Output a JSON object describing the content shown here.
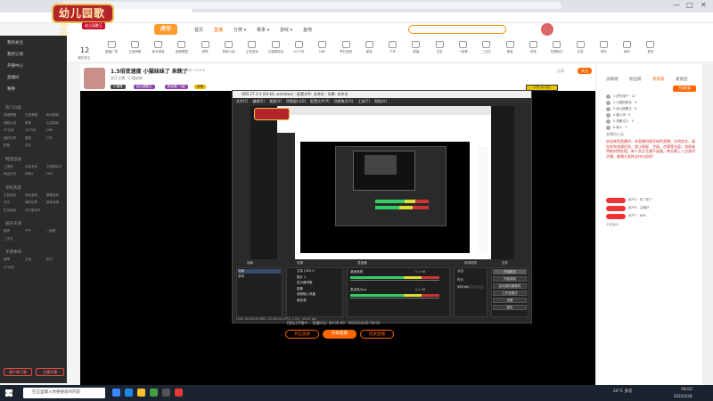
{
  "browser": {
    "tabs": [
      {
        "label": "虎牙直播-中国领先的互动直播平台"
      },
      {
        "label": "抖音直播-中国领先的互动直播..."
      },
      {
        "label": "新标签页"
      }
    ],
    "new_tab": "+",
    "win_controls": [
      "—",
      "□",
      "✕"
    ]
  },
  "overlay_logo": {
    "text": "幼儿园歌王",
    "sub": "幼儿园歌王"
  },
  "site": {
    "logo_text": "虎牙",
    "nav": [
      "首页",
      "直播",
      "分类 ▾",
      "赛事 ▾",
      "游戏 ▾",
      "鱼吧"
    ],
    "active_nav": 1,
    "follow_count": "12",
    "follow_label": "我的关注",
    "icon_row": [
      "直播广场",
      "王者荣耀",
      "和平精英",
      "英雄联盟",
      "原神",
      "穿越火线",
      "主机游戏",
      "王者模拟战",
      "QQ飞车",
      "DNF",
      "梦幻西游",
      "星秀",
      "户外",
      "颜值",
      "交友",
      "一起看",
      "二次元",
      "美食",
      "体育",
      "吃喝玩乐",
      "手游",
      "单机",
      "娱乐",
      "更多"
    ]
  },
  "sidebar": {
    "items": [
      "我的关注",
      "我的订阅",
      "开播中心",
      "直播间",
      "赛事"
    ],
    "section1": "热门分类",
    "grid1": [
      "英雄联盟",
      "王者荣耀",
      "和平精英",
      "穿越火线",
      "原神",
      "主机游戏",
      "CF手游",
      "QQ飞车",
      "DNF",
      "我的世界",
      "星秀",
      "户外",
      "颜值",
      "交友"
    ],
    "section2": "网游竞技",
    "grid2": [
      "三国杀",
      "永劫无间",
      "天涯明月刀",
      "命运方舟",
      "剑网3",
      "FIFA"
    ],
    "section3": "单机热游",
    "grid3": [
      "主机游戏",
      "怀旧游戏",
      "暴雪游戏",
      "方舟",
      "我的世界",
      "使命召唤",
      "生化危机",
      "艾尔登法环"
    ],
    "section4": "娱乐天地",
    "grid4": [
      "星秀",
      "户外",
      "一起看",
      "二次元"
    ],
    "section5": "手游休闲",
    "grid5": [
      "原神",
      "王者",
      "和平",
      "CF手游"
    ],
    "footer_btns": [
      "客户端下载",
      "主播开播"
    ]
  },
  "stream": {
    "title": "1.5倍变速度 小猫妹妹了 来晚了",
    "subtitle": "虎牙主播 · 小猫妹妹",
    "room_no": "房间号 123456",
    "badges": [
      "小猫咪",
      "幼儿园歌王",
      "粉丝团 · 1级",
      "虎粮"
    ],
    "actions": [
      "分享",
      "关注"
    ],
    "popularity": "人气 12.3万"
  },
  "obs": {
    "title": "OBS 27.2.4 (64 bit, windows) - 配置文件: 未命名 - 场景: 未命名",
    "menu": [
      "文件(F)",
      "编辑(E)",
      "视图(V)",
      "停靠窗口(D)",
      "配置文件(P)",
      "场景集合(S)",
      "工具(T)",
      "帮助(H)"
    ],
    "panels": [
      "场景",
      "来源",
      "混音器",
      "转场特效",
      "控件"
    ],
    "scenes": [
      "场景",
      "游戏"
    ],
    "sources": [
      "文本 (GDI+)",
      "图片 2",
      "显示器采集",
      "图像",
      "音频输入采集",
      "媒体源"
    ],
    "mixer": [
      "桌面音频",
      "麦克风/Aux"
    ],
    "mixer_db": [
      "0.0 dB",
      "0.0 dB"
    ],
    "transition": {
      "label": "淡出",
      "duration_label": "时长",
      "duration": "300 ms"
    },
    "controls": [
      "开始推流",
      "开始录制",
      "启动虚拟摄像机",
      "工作室模式",
      "设置",
      "退出"
    ],
    "status": "LIVE: 00:00:00   REC: 00:00:00   CPU: 2.3%, 30.00 fps"
  },
  "below_video": {
    "caption": "[图标]开播中... 直播时长: 00:00:00 · 2022/03/28 18:02",
    "btns": [
      "开启美颜",
      "开始直播",
      "结束直播"
    ]
  },
  "right_panel": {
    "tabs": [
      "贡献榜",
      "粉丝榜",
      "贵宾席",
      "真爱团"
    ],
    "active_tab": 2,
    "promo": "开通贵族",
    "rank_rows": [
      "1 虎牙用户 · 12",
      "2 小猫的粉丝 · 9",
      "3 幼儿园歌王 · 8",
      "4 路人甲 · 5",
      "5 虎粮达人 · 3",
      "6 新人 · 1"
    ],
    "notice_label": "直播间公告",
    "notice": "欢迎来到直播间，本直播间倡导绿色直播，文明发言，请勿发布违规信息，禁止刷屏、涉政、涉黄等内容，违规者将被封禁处理。新人关注主播不迷路，每天晚上八点准时开播，感谢大家的支持与陪伴！",
    "chat": [
      "用户A · 来了来了",
      "用户B · 主播好",
      "用户C · 666"
    ],
    "chat_tag": "本直播间"
  },
  "taskbar": {
    "search_placeholder": "在这里输入你要搜索的内容",
    "weather": "24°C 多云",
    "time": "18:02",
    "date": "2022/3/28"
  },
  "colors": {
    "accent": "#ff6600",
    "sidebar_bg": "#2b2b2b",
    "video_bg": "#000000",
    "logo_red": "#b3242b"
  }
}
